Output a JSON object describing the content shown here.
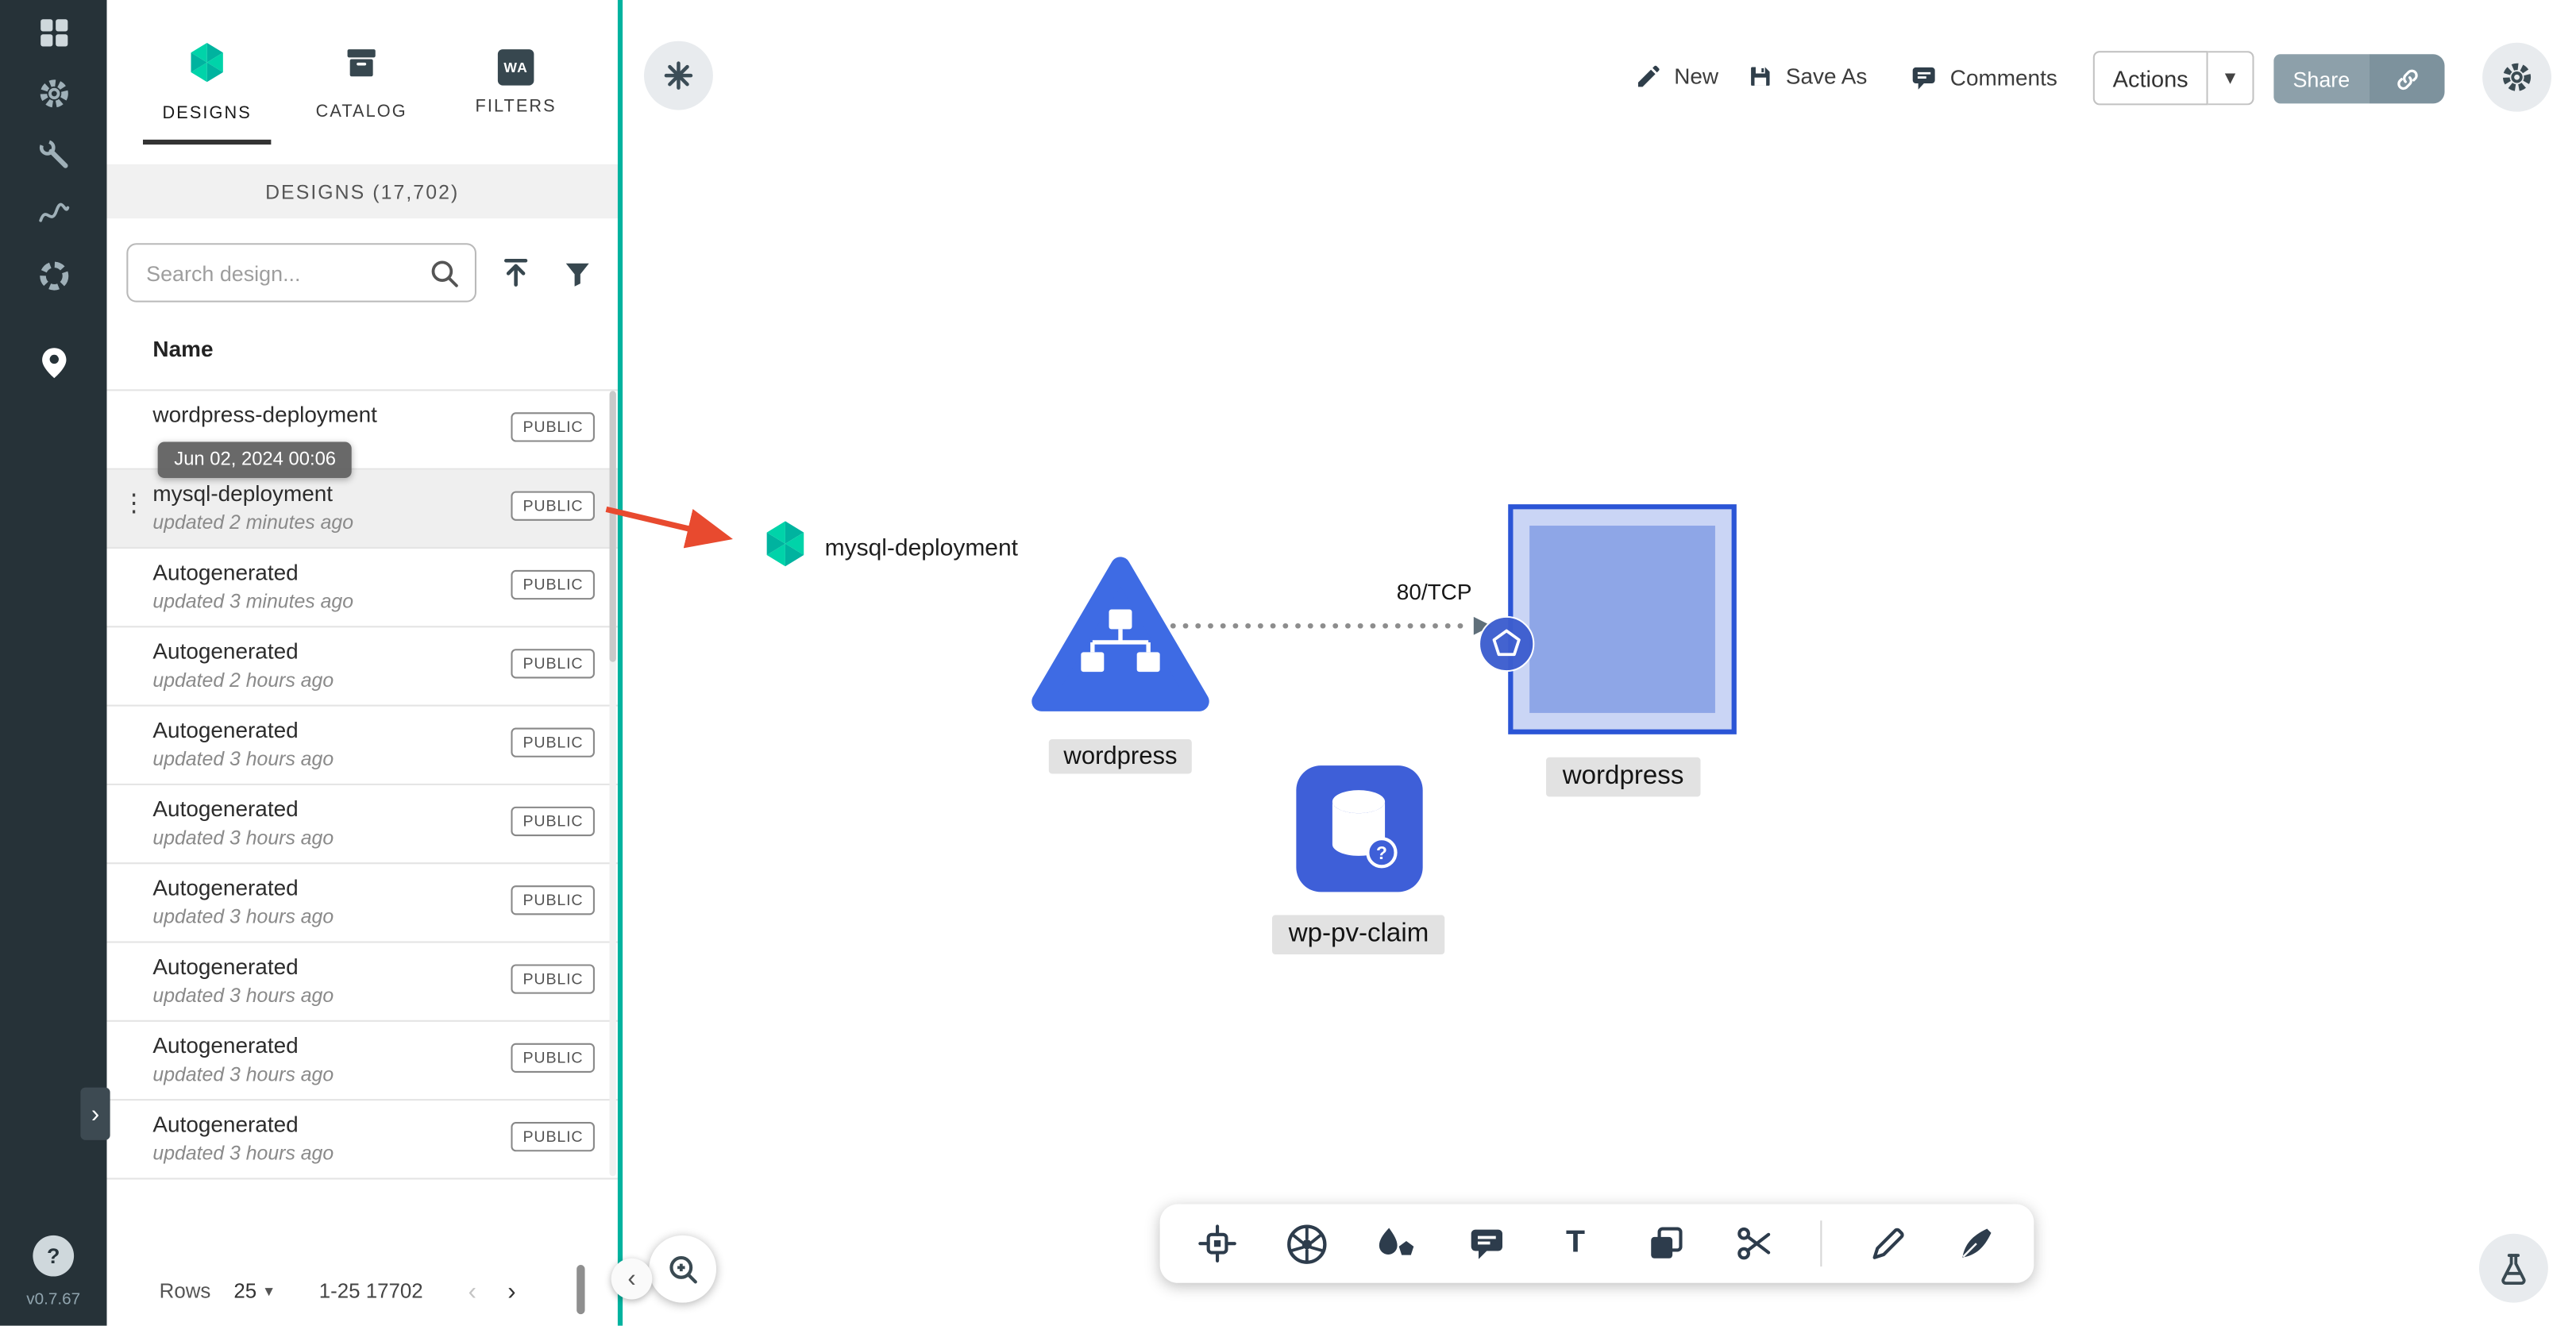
{
  "app": {
    "version": "v0.7.67",
    "help_label": "?"
  },
  "sidebar": {
    "icons": [
      "dashboard-icon",
      "settings-gear-icon",
      "toolbox-icon",
      "curve-icon",
      "segments-icon",
      "kanvas-pin-icon"
    ]
  },
  "panel": {
    "tabs": [
      {
        "label": "DESIGNS"
      },
      {
        "label": "CATALOG"
      },
      {
        "label": "FILTERS",
        "icon_text": "WA"
      }
    ],
    "header": "DESIGNS (17,702)",
    "search_placeholder": "Search design...",
    "name_column": "Name",
    "tooltip": "Jun 02, 2024 00:06",
    "rows": [
      {
        "name": "wordpress-deployment",
        "updated": "",
        "badge": "PUBLIC"
      },
      {
        "name": "mysql-deployment",
        "updated": "updated 2 minutes ago",
        "badge": "PUBLIC"
      },
      {
        "name": "Autogenerated",
        "updated": "updated 3 minutes ago",
        "badge": "PUBLIC"
      },
      {
        "name": "Autogenerated",
        "updated": "updated 2 hours ago",
        "badge": "PUBLIC"
      },
      {
        "name": "Autogenerated",
        "updated": "updated 3 hours ago",
        "badge": "PUBLIC"
      },
      {
        "name": "Autogenerated",
        "updated": "updated 3 hours ago",
        "badge": "PUBLIC"
      },
      {
        "name": "Autogenerated",
        "updated": "updated 3 hours ago",
        "badge": "PUBLIC"
      },
      {
        "name": "Autogenerated",
        "updated": "updated 3 hours ago",
        "badge": "PUBLIC"
      },
      {
        "name": "Autogenerated",
        "updated": "updated 3 hours ago",
        "badge": "PUBLIC"
      },
      {
        "name": "Autogenerated",
        "updated": "updated 3 hours ago",
        "badge": "PUBLIC"
      }
    ],
    "footer": {
      "rows_label": "Rows",
      "per_page": "25",
      "range": "1-25 17702"
    }
  },
  "canvas": {
    "toolbar": {
      "new": "New",
      "save_as": "Save As",
      "comments": "Comments",
      "actions": "Actions",
      "share": "Share"
    },
    "edge_label": "80/TCP",
    "nodes": {
      "mysql": {
        "label": "mysql-deployment"
      },
      "wordpress_deployment": {
        "label": "wordpress"
      },
      "wordpress_service": {
        "label": "wordpress"
      },
      "wp_pv_claim": {
        "label": "wp-pv-claim"
      }
    },
    "dock_icons": [
      "component-icon",
      "kubernetes-icon",
      "shapes-icon",
      "comment-icon",
      "text-tool-icon",
      "copy-icon",
      "scissors-icon",
      "pencil-icon",
      "pen-icon"
    ]
  },
  "colors": {
    "accent": "#00B39F",
    "node_blue": "#3E63D8",
    "sidebar_bg": "#263238",
    "arrow_red": "#E84A2F"
  }
}
